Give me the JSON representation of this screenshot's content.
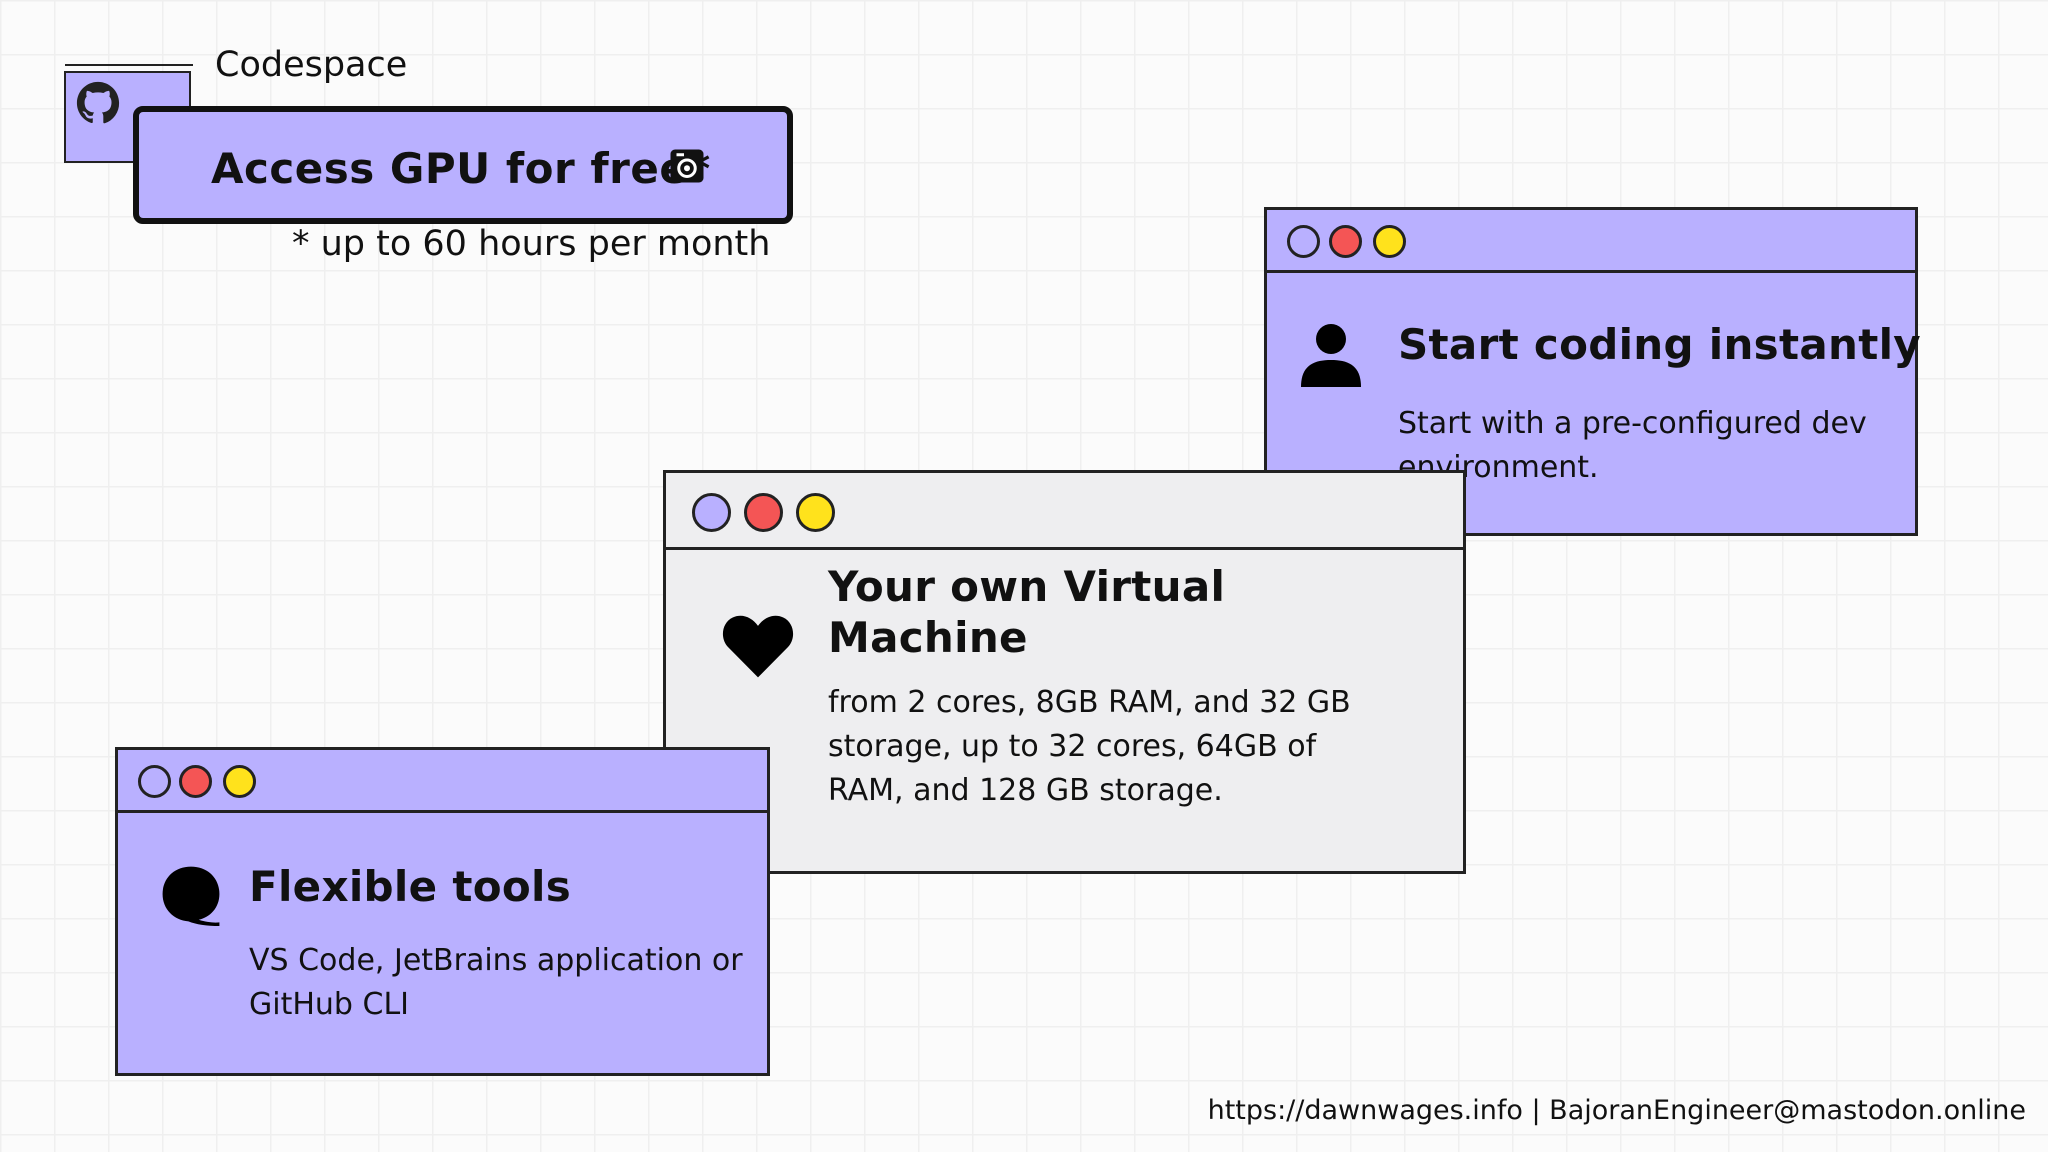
{
  "header": {
    "folder_label": "Codespace\ns",
    "gpu_title": "Access GPU for free*",
    "gpu_note": "* up to 60 hours per month"
  },
  "cards": {
    "start": {
      "title": "Start coding instantly",
      "text": "Start with a pre-configured dev environment."
    },
    "vm": {
      "title": "Your own Virtual Machine",
      "text": "from 2 cores, 8GB RAM, and 32 GB storage, up to 32 cores, 64GB of RAM, and 128 GB storage."
    },
    "flex": {
      "title": "Flexible tools",
      "text": "VS Code, JetBrains application or GitHub CLI"
    }
  },
  "footer": {
    "text": "https://dawnwages.info | BajoranEngineer@mastodon.online"
  },
  "colors": {
    "lavender": "#b9b0ff",
    "light_gray": "#eeeef0",
    "red": "#f45555",
    "yellow": "#ffe21c",
    "outline": "#222222"
  },
  "icons": [
    "github-icon",
    "gpu-chip-icon",
    "user-icon",
    "heart-icon",
    "speech-bubble-icon"
  ]
}
